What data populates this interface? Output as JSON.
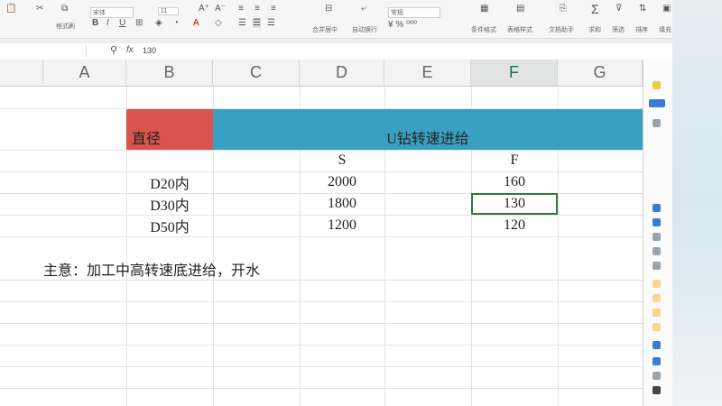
{
  "ribbon": {
    "font_name": "宋体",
    "font_size": "11",
    "format_painter": "格式刷",
    "wrap_label": "换行",
    "number_format": "常规",
    "merge_label": "合并居中",
    "autowrap_label": "自动换行",
    "cond_format_label": "条件格式",
    "cell_style_label": "表格样式",
    "doc_assist_label": "文档助手",
    "sum_label": "求和",
    "filter_label": "筛选",
    "sort_label": "排序",
    "fill_label": "填充"
  },
  "formula_bar": {
    "fx": "fx",
    "value": "130"
  },
  "columns": [
    "A",
    "B",
    "C",
    "D",
    "E",
    "F",
    "G"
  ],
  "selected_column": "F",
  "table": {
    "header_left": "直径",
    "header_right": "U钻转速进给",
    "col_s": "S",
    "col_f": "F",
    "rows": [
      {
        "diameter": "D20内",
        "s": "2000",
        "f": "160"
      },
      {
        "diameter": "D30内",
        "s": "1800",
        "f": "130"
      },
      {
        "diameter": "D50内",
        "s": "1200",
        "f": "120"
      }
    ]
  },
  "note": "主意：加工中高转速底进给，开水",
  "colors": {
    "red_header": "#d9534f",
    "blue_header": "#3aa0c2",
    "active_border": "#2e7d32"
  }
}
